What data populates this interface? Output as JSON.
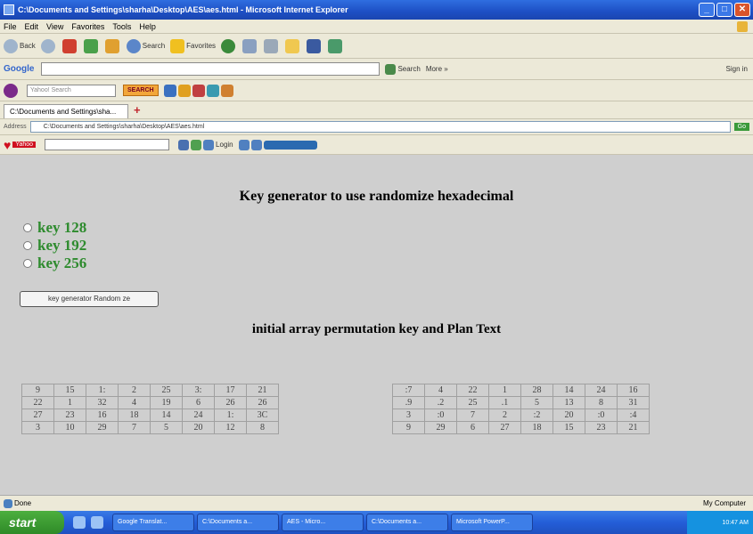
{
  "window": {
    "title": "C:\\Documents and Settings\\sharha\\Desktop\\AES\\aes.html - Microsoft Internet Explorer",
    "minimize": "_",
    "maximize": "□",
    "close": "✕"
  },
  "menu": [
    "File",
    "Edit",
    "View",
    "Favorites",
    "Tools",
    "Help"
  ],
  "toolbar": {
    "back_label": "Back",
    "search_label": "Search",
    "favorites_label": "Favorites"
  },
  "googlebar": {
    "logo": "Google",
    "search_label": "Search",
    "more_label": "More »",
    "signin_label": "Sign in"
  },
  "yahoobar": {
    "search_placeholder": "Yahoo! Search",
    "search_button": "SEARCH"
  },
  "tabs": {
    "active_tab": "C:\\Documents and Settings\\sha...",
    "new_tab": "+"
  },
  "address": {
    "label": "Address",
    "url": "C:\\Documents and Settings\\sharha\\Desktop\\AES\\aes.html",
    "go": "Go"
  },
  "heartbar": {
    "brand": "Yahoo",
    "login_label": "Login"
  },
  "page": {
    "heading": "Key generator to use randomize hexadecimal",
    "radio_options": [
      "key 128",
      "key 192",
      "key 256"
    ],
    "button_label": "key generator Random ze",
    "subheading": "initial array permutation key and Plan Text",
    "left_table": [
      [
        "9",
        "15",
        "1:",
        "2",
        "25",
        "3:",
        "17",
        "21"
      ],
      [
        "22",
        "1",
        "32",
        "4",
        "19",
        "6",
        "26",
        "26"
      ],
      [
        "27",
        "23",
        "16",
        "18",
        "14",
        "24",
        "1:",
        "3C"
      ],
      [
        "3",
        "10",
        "29",
        "7",
        "5",
        "20",
        "12",
        "8"
      ]
    ],
    "right_table": [
      [
        ":7",
        "4",
        "22",
        "1",
        "28",
        "14",
        "24",
        "16"
      ],
      [
        ".9",
        ".2",
        "25",
        ".1",
        "5",
        "13",
        "8",
        "31"
      ],
      [
        "3",
        ":0",
        "7",
        "2",
        ":2",
        "20",
        ":0",
        ":4"
      ],
      [
        "9",
        "29",
        "6",
        "27",
        "18",
        "15",
        "23",
        "21"
      ]
    ]
  },
  "status": {
    "left": "Done",
    "zone": "My Computer"
  },
  "taskbar": {
    "start": "start",
    "tasks": [
      "Google Translat...",
      "C:\\Documents a...",
      "AES - Micro...",
      "C:\\Documents a...",
      "Microsoft PowerP..."
    ],
    "tray": "10:47 AM"
  }
}
